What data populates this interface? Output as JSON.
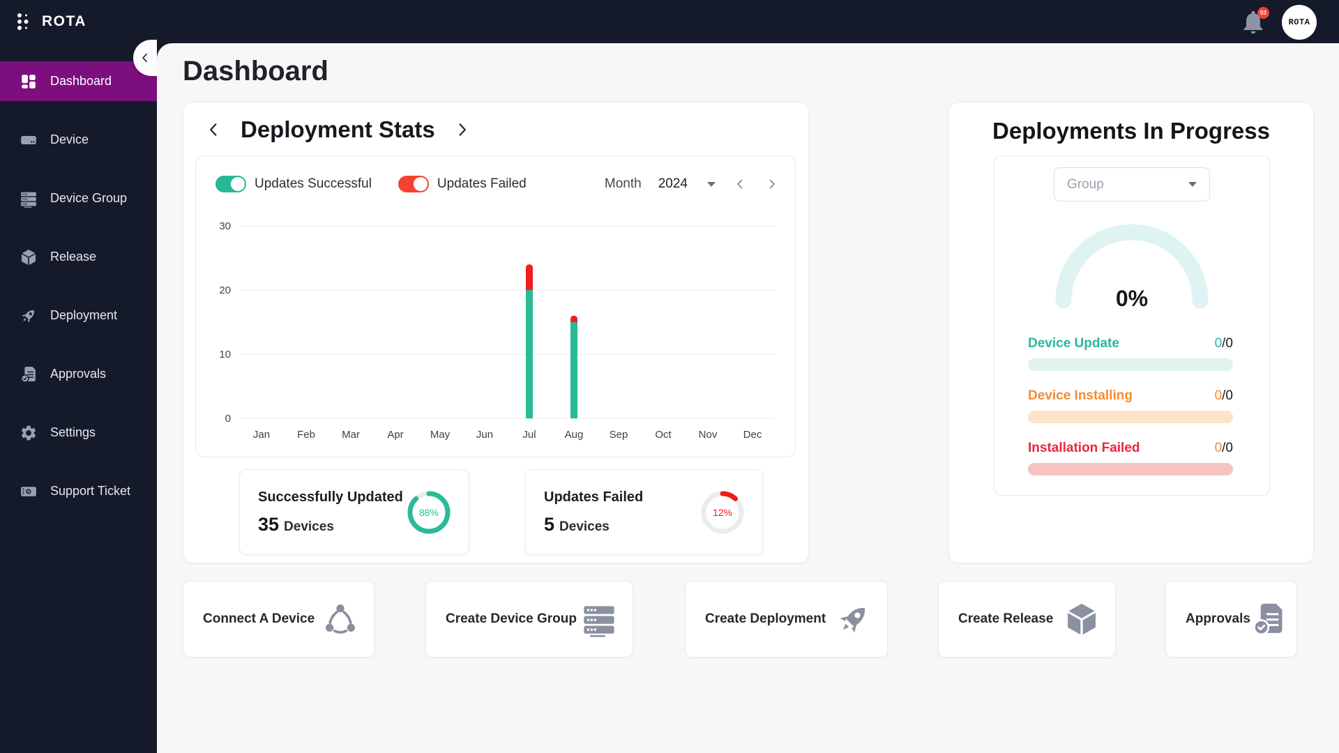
{
  "app": {
    "name": "ROTA",
    "notification_count": "03",
    "avatar_text": "ROTA"
  },
  "colors": {
    "chrome": "#151A2B",
    "active_purple": "#7D0E7D",
    "green": "#2ABA97",
    "red_toggle": "#F4432F",
    "red_chart": "#F01F1F",
    "gauge_track": "#DFF4F2"
  },
  "sidebar": {
    "items": [
      {
        "label": "Dashboard",
        "icon": "dashboard",
        "active": true
      },
      {
        "label": "Device",
        "icon": "device",
        "active": false
      },
      {
        "label": "Device Group",
        "icon": "device-group",
        "active": false
      },
      {
        "label": "Release",
        "icon": "cube",
        "active": false
      },
      {
        "label": "Deployment",
        "icon": "rocket",
        "active": false
      },
      {
        "label": "Approvals",
        "icon": "doc-check",
        "active": false
      },
      {
        "label": "Settings",
        "icon": "gear",
        "active": false
      },
      {
        "label": "Support Ticket",
        "icon": "ticket",
        "active": false
      }
    ]
  },
  "page": {
    "title": "Dashboard"
  },
  "deployment_stats": {
    "title": "Deployment Stats",
    "toggles": [
      {
        "label": "Updates Successful",
        "color": "#29B795",
        "on": true
      },
      {
        "label": "Updates Failed",
        "color": "#F4432F",
        "on": true
      }
    ],
    "period": {
      "label": "Month",
      "year": "2024"
    },
    "chart_data": {
      "type": "bar",
      "stacked": true,
      "categories": [
        "Jan",
        "Feb",
        "Mar",
        "Apr",
        "May",
        "Jun",
        "Jul",
        "Aug",
        "Sep",
        "Oct",
        "Nov",
        "Dec"
      ],
      "series": [
        {
          "name": "Updates Successful",
          "color": "#2ABA97",
          "values": [
            0,
            0,
            0,
            0,
            0,
            0,
            20,
            15,
            0,
            0,
            0,
            0
          ]
        },
        {
          "name": "Updates Failed",
          "color": "#F01F1F",
          "values": [
            0,
            0,
            0,
            0,
            0,
            0,
            4,
            1,
            0,
            0,
            0,
            0
          ]
        }
      ],
      "ylim": [
        0,
        30
      ],
      "yticks": [
        0,
        10,
        20,
        30
      ],
      "grid": true,
      "legend_position": "top"
    },
    "summary": [
      {
        "title": "Successfully Updated",
        "count": "35",
        "unit": "Devices",
        "percent": "88%",
        "value": 88,
        "color": "#2ABA97"
      },
      {
        "title": "Updates Failed",
        "count": "5",
        "unit": "Devices",
        "percent": "12%",
        "value": 12,
        "color": "#EE1B1B"
      }
    ]
  },
  "deployments_in_progress": {
    "title": "Deployments In Progress",
    "group_placeholder": "Group",
    "gauge": {
      "percent": "0%"
    },
    "rows": [
      {
        "label": "Device Update",
        "value": "0",
        "total": "0",
        "color": "#2BB5A0",
        "value_color": "#2BB5A0",
        "bar_color": "#E0F3EF"
      },
      {
        "label": "Device Installing",
        "value": "0",
        "total": "0",
        "color": "#F68A2E",
        "value_color": "#F68A2E",
        "bar_color": "#FBE4C7"
      },
      {
        "label": "Installation Failed",
        "value": "0",
        "total": "0",
        "color": "#F2223C",
        "value_color": "#F68A2E",
        "bar_color": "#F6C3C3"
      }
    ]
  },
  "quick_actions": [
    {
      "label": "Connect A Device",
      "icon": "connect"
    },
    {
      "label": "Create Device Group",
      "icon": "device-group"
    },
    {
      "label": "Create Deployment",
      "icon": "rocket"
    },
    {
      "label": "Create Release",
      "icon": "cube"
    },
    {
      "label": "Approvals",
      "icon": "doc-check"
    }
  ]
}
